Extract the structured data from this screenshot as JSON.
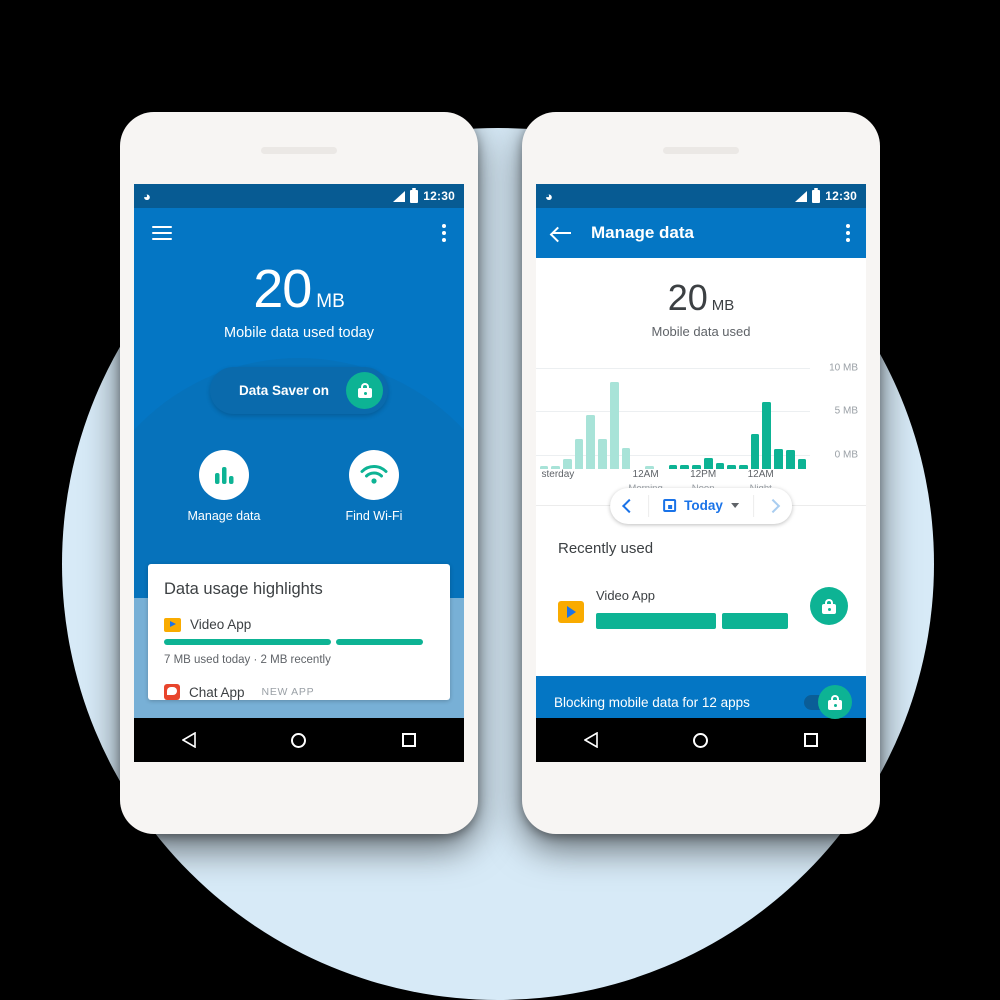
{
  "colors": {
    "background": "#000000",
    "circle": "#d7eaf7",
    "primary_blue": "#0476c4",
    "statusbar_blue": "#075b93",
    "accent_teal": "#0db394",
    "chart_teal": "#0db394",
    "chart_teal_light": "#a8e3d8",
    "link_blue": "#1a73e8"
  },
  "phone1": {
    "status_bar": {
      "brand_icon": "datally-icon",
      "signal_icon": "signal-icon",
      "battery_icon": "battery-icon",
      "clock": "12:30"
    },
    "app_bar": {
      "menu_icon": "hamburger-menu-icon",
      "overflow_icon": "kebab-menu-icon"
    },
    "hero": {
      "value": "20",
      "unit": "MB",
      "caption": "Mobile data used today"
    },
    "data_saver": {
      "label": "Data Saver on",
      "lock_icon": "lock-icon"
    },
    "quick_actions": [
      {
        "label": "Manage data",
        "icon": "bar-chart-icon"
      },
      {
        "label": "Find Wi-Fi",
        "icon": "wifi-icon"
      }
    ],
    "card": {
      "title": "Data usage highlights",
      "apps": [
        {
          "name": "Video App",
          "icon": "video-app-icon",
          "badge": "",
          "meta": "7 MB used today  ·  2 MB recently",
          "segments": [
            62,
            32
          ]
        },
        {
          "name": "Chat App",
          "icon": "chat-app-icon",
          "badge": "NEW APP",
          "meta": "",
          "segments": []
        }
      ]
    },
    "nav_bar": {
      "back": "back-nav-icon",
      "home": "home-nav-icon",
      "recents": "recents-nav-icon"
    }
  },
  "phone2": {
    "status_bar": {
      "brand_icon": "datally-icon",
      "signal_icon": "signal-icon",
      "battery_icon": "battery-icon",
      "clock": "12:30"
    },
    "app_bar": {
      "back_icon": "arrow-back-icon",
      "title": "Manage data",
      "overflow_icon": "kebab-menu-icon"
    },
    "hero": {
      "value": "20",
      "unit": "MB",
      "caption": "Mobile data used"
    },
    "date_selector": {
      "prev_icon": "chevron-left-icon",
      "calendar_icon": "calendar-icon",
      "label": "Today",
      "caret_icon": "chevron-down-icon",
      "next_icon": "chevron-right-icon"
    },
    "recently_used": {
      "title": "Recently used",
      "rows": [
        {
          "name": "Video App",
          "icon": "video-app-icon",
          "segments": [
            60,
            34
          ],
          "lock_icon": "lock-icon"
        }
      ]
    },
    "snackbar": {
      "text": "Blocking mobile data for 12 apps",
      "toggle_icon": "lock-toggle-icon",
      "toggle_state": "on"
    },
    "nav_bar": {
      "back": "back-nav-icon",
      "home": "home-nav-icon",
      "recents": "recents-nav-icon"
    }
  },
  "chart_data": {
    "type": "bar",
    "title": "Mobile data used",
    "xlabel": "",
    "ylabel": "MB",
    "ylim": [
      0,
      11
    ],
    "yticks": [
      0,
      5,
      10
    ],
    "ytick_labels": [
      "0 MB",
      "5 MB",
      "10 MB"
    ],
    "grid": true,
    "legend": false,
    "xtick_labels": [
      {
        "primary": "sterday",
        "secondary": ""
      },
      {
        "primary": "12AM",
        "secondary": "Morning"
      },
      {
        "primary": "12PM",
        "secondary": "Noon"
      },
      {
        "primary": "12AM",
        "secondary": "Night"
      }
    ],
    "xtick_positions_pct": [
      8,
      40,
      61,
      82
    ],
    "series": [
      {
        "name": "Yesterday",
        "color": "#a8e3d8",
        "values": [
          0.3,
          0.25,
          1.2,
          3.4,
          6.2,
          3.4,
          10.0,
          2.4,
          0.0,
          0.35
        ]
      },
      {
        "name": "Today",
        "color": "#0db394",
        "values": [
          0.5,
          0.5,
          0.5,
          1.3,
          0.7,
          0.45,
          0.5,
          4.0,
          7.7,
          2.3,
          2.2,
          1.2
        ]
      }
    ]
  }
}
